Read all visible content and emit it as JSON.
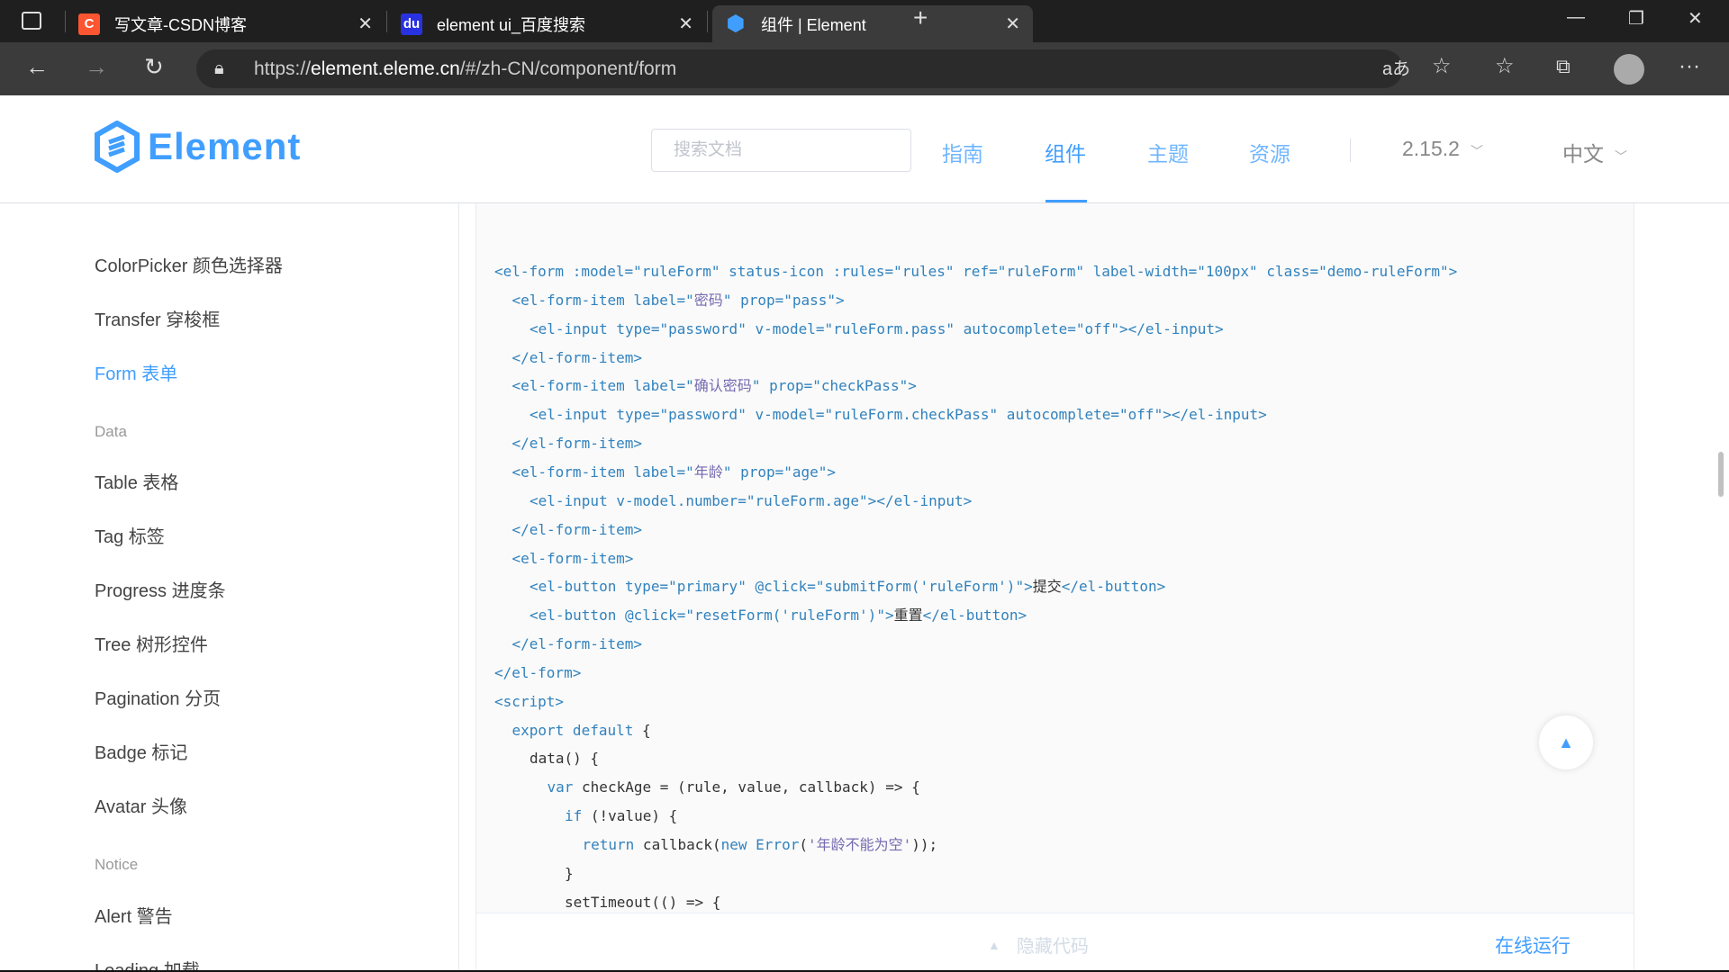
{
  "browser": {
    "tabs": [
      {
        "title": "写文章-CSDN博客",
        "icon": "csdn-icon",
        "color": "#fc5531",
        "glyph": "C"
      },
      {
        "title": "element ui_百度搜索",
        "icon": "baidu-paw-icon",
        "color": "#2932e1",
        "glyph": "du"
      },
      {
        "title": "组件 | Element",
        "icon": "element-logo-icon",
        "color": "#409eff",
        "glyph": "⬢",
        "active": true
      }
    ],
    "url_scheme": "https://",
    "url_host": "element.eleme.cn",
    "url_path": "/#/zh-CN/component/form"
  },
  "header": {
    "logo_text": "Element",
    "search_placeholder": "搜索文档",
    "nav": [
      "指南",
      "组件",
      "主题",
      "资源"
    ],
    "active_nav": 1,
    "version": "2.15.2",
    "language": "中文",
    "accent": "#409eff"
  },
  "sidebar": {
    "entries": [
      {
        "type": "item",
        "label": "ColorPicker 颜色选择器"
      },
      {
        "type": "item",
        "label": "Transfer 穿梭框"
      },
      {
        "type": "item",
        "label": "Form 表单",
        "active": true
      },
      {
        "type": "group",
        "label": "Data"
      },
      {
        "type": "item",
        "label": "Table 表格"
      },
      {
        "type": "item",
        "label": "Tag 标签"
      },
      {
        "type": "item",
        "label": "Progress 进度条"
      },
      {
        "type": "item",
        "label": "Tree 树形控件"
      },
      {
        "type": "item",
        "label": "Pagination 分页"
      },
      {
        "type": "item",
        "label": "Badge 标记"
      },
      {
        "type": "item",
        "label": "Avatar 头像"
      },
      {
        "type": "group",
        "label": "Notice"
      },
      {
        "type": "item",
        "label": "Alert 警告"
      },
      {
        "type": "item",
        "label": "Loading 加载"
      }
    ]
  },
  "code": {
    "lines": [
      {
        "indent": 0,
        "tokens": [
          [
            "<el-form :model=\"ruleForm\" status-icon :rules=\"rules\" ref=\"ruleForm\" label-width=\"100px\" class=\"demo-ruleForm\">",
            "tag"
          ]
        ]
      },
      {
        "indent": 1,
        "tokens": [
          [
            "<el-form-item label=\"",
            "tag"
          ],
          [
            "密码",
            "str"
          ],
          [
            "\" prop=\"pass\">",
            "tag"
          ]
        ]
      },
      {
        "indent": 2,
        "tokens": [
          [
            "<el-input type=\"password\" v-model=\"ruleForm.pass\" autocomplete=\"off\"></el-input>",
            "tag"
          ]
        ]
      },
      {
        "indent": 1,
        "tokens": [
          [
            "</el-form-item>",
            "tag"
          ]
        ]
      },
      {
        "indent": 1,
        "tokens": [
          [
            "<el-form-item label=\"",
            "tag"
          ],
          [
            "确认密码",
            "str"
          ],
          [
            "\" prop=\"checkPass\">",
            "tag"
          ]
        ]
      },
      {
        "indent": 2,
        "tokens": [
          [
            "<el-input type=\"password\" v-model=\"ruleForm.checkPass\" autocomplete=\"off\"></el-input>",
            "tag"
          ]
        ]
      },
      {
        "indent": 1,
        "tokens": [
          [
            "</el-form-item>",
            "tag"
          ]
        ]
      },
      {
        "indent": 1,
        "tokens": [
          [
            "<el-form-item label=\"",
            "tag"
          ],
          [
            "年龄",
            "str"
          ],
          [
            "\" prop=\"age\">",
            "tag"
          ]
        ]
      },
      {
        "indent": 2,
        "tokens": [
          [
            "<el-input v-model.number=\"ruleForm.age\"></el-input>",
            "tag"
          ]
        ]
      },
      {
        "indent": 1,
        "tokens": [
          [
            "</el-form-item>",
            "tag"
          ]
        ]
      },
      {
        "indent": 1,
        "tokens": [
          [
            "<el-form-item>",
            "tag"
          ]
        ]
      },
      {
        "indent": 2,
        "tokens": [
          [
            "<el-button type=\"primary\" @click=\"submitForm('ruleForm')\">",
            "tag"
          ],
          [
            "提交",
            "plain"
          ],
          [
            "</el-button>",
            "tag"
          ]
        ]
      },
      {
        "indent": 2,
        "tokens": [
          [
            "<el-button @click=\"resetForm('ruleForm')\">",
            "tag"
          ],
          [
            "重置",
            "plain"
          ],
          [
            "</el-button>",
            "tag"
          ]
        ]
      },
      {
        "indent": 1,
        "tokens": [
          [
            "</el-form-item>",
            "tag"
          ]
        ]
      },
      {
        "indent": 0,
        "tokens": [
          [
            "</el-form>",
            "tag"
          ]
        ]
      },
      {
        "indent": 0,
        "tokens": [
          [
            "<script>",
            "tag"
          ]
        ]
      },
      {
        "indent": 1,
        "tokens": [
          [
            "export default",
            "kw"
          ],
          [
            " {",
            "plain"
          ]
        ]
      },
      {
        "indent": 2,
        "tokens": [
          [
            "data() {",
            "plain"
          ]
        ]
      },
      {
        "indent": 3,
        "tokens": [
          [
            "var",
            "kw"
          ],
          [
            " checkAge = (rule, value, callback) => {",
            "plain"
          ]
        ]
      },
      {
        "indent": 4,
        "tokens": [
          [
            "if",
            "kw"
          ],
          [
            " (!value) {",
            "plain"
          ]
        ]
      },
      {
        "indent": 5,
        "tokens": [
          [
            "return",
            "kw"
          ],
          [
            " callback(",
            "plain"
          ],
          [
            "new",
            "kw"
          ],
          [
            " ",
            "plain"
          ],
          [
            "Error",
            "kw"
          ],
          [
            "(",
            "plain"
          ],
          [
            "'年龄不能为空'",
            "str"
          ],
          [
            "));",
            "plain"
          ]
        ]
      },
      {
        "indent": 4,
        "tokens": [
          [
            "}",
            "plain"
          ]
        ]
      },
      {
        "indent": 4,
        "tokens": [
          [
            "setTimeout(() => {",
            "plain"
          ]
        ]
      }
    ]
  },
  "controls": {
    "hide_code": "隐藏代码",
    "run_online": "在线运行"
  }
}
